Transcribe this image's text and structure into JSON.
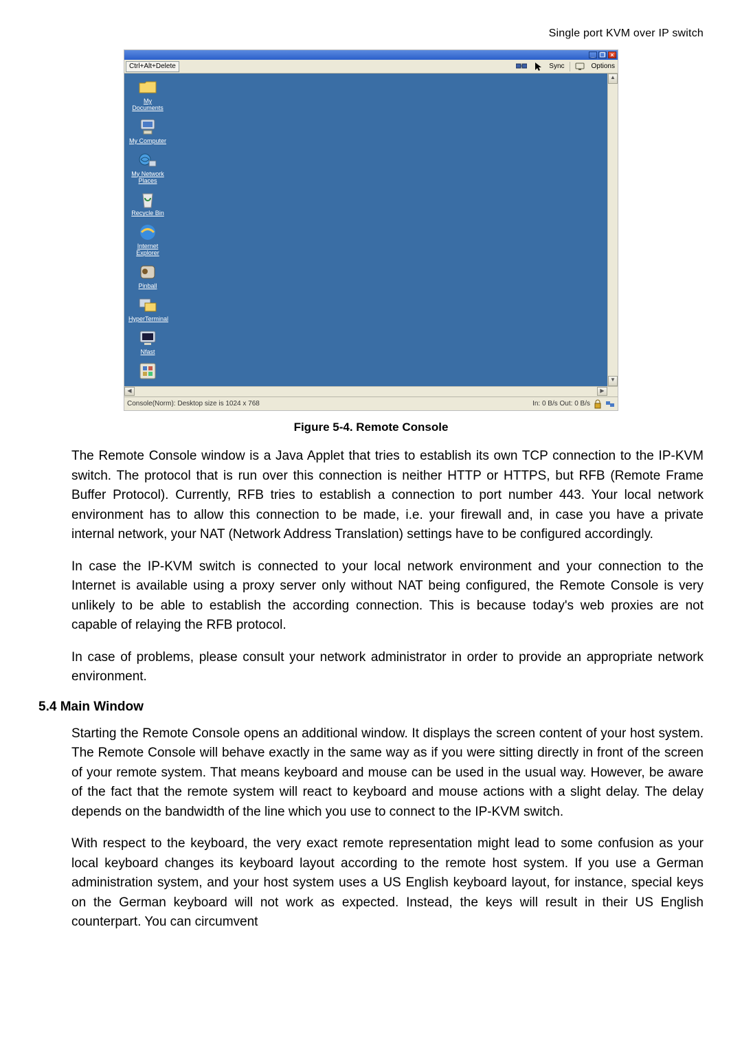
{
  "header": {
    "product_name": "Single port KVM over IP switch"
  },
  "console": {
    "buttons": {
      "ctrl_alt_del": "Ctrl+Alt+Delete",
      "sync": "Sync",
      "options": "Options"
    },
    "desktop_icons": [
      "My Documents",
      "My Computer",
      "My Network Places",
      "Recycle Bin",
      "Internet Explorer",
      "Pinball",
      "HyperTerminal",
      "Nfast",
      ""
    ],
    "status_left": "Console(Norm): Desktop size is 1024 x 768",
    "status_right": "In: 0 B/s Out: 0 B/s"
  },
  "figure_caption": "Figure 5-4. Remote Console",
  "paragraphs": {
    "p1": "The Remote Console window is a Java Applet that tries to establish its own TCP connection to the IP-KVM switch. The protocol that is run over this connection is neither HTTP or HTTPS, but RFB (Remote Frame Buffer Protocol). Currently, RFB tries to establish a connection to port number 443. Your local network environment has to allow this connection to be made, i.e. your firewall and, in case you have a private internal network, your NAT (Network Address Translation) settings have to be configured accordingly.",
    "p2": "In case the IP-KVM switch is connected to your local network environment and your connection to the Internet is available using a proxy server only without NAT being configured, the Remote Console is very unlikely to be able to establish the according connection. This is because today's web proxies are not capable of relaying the RFB protocol.",
    "p3": "In case of problems, please consult your network administrator in order to provide an appropriate network environment.",
    "p4": "Starting the Remote Console opens an additional window. It displays the screen content of your host system. The Remote Console will behave exactly in the same way as if you were sitting directly in front of the screen of your remote system. That means keyboard and mouse can be used in the usual way. However, be aware of the fact that the remote system will react to keyboard and mouse actions with a slight delay. The delay depends on the bandwidth of the line which you use to connect to the IP-KVM switch.",
    "p5": "With respect to the keyboard, the very exact remote representation might lead to some confusion as your local keyboard changes its keyboard layout according to the remote host system. If you use a German administration system, and your host system uses a US English keyboard layout, for instance, special keys on the German keyboard will not work as expected. Instead, the keys will result in their US English counterpart. You can circumvent"
  },
  "section_heading": "5.4 Main Window"
}
